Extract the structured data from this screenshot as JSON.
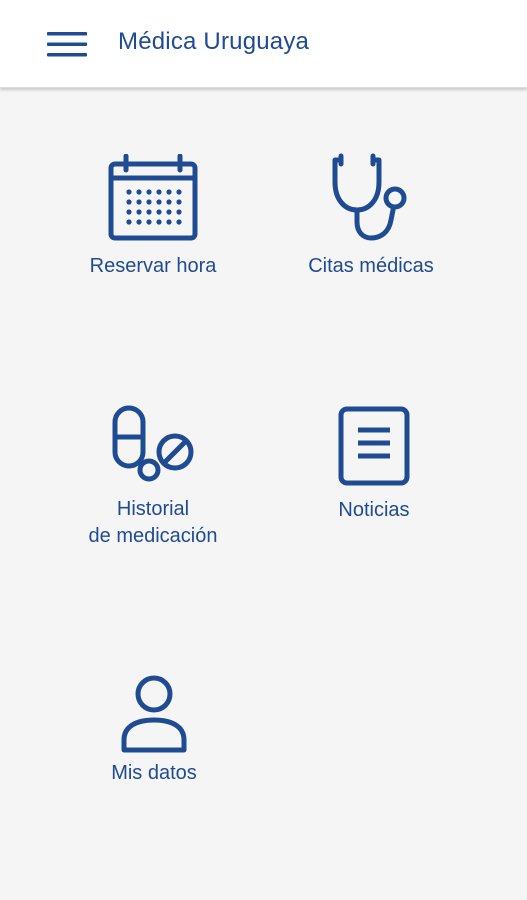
{
  "header": {
    "title": "Médica Uruguaya",
    "menu_icon": "hamburger-menu-icon"
  },
  "menu": {
    "items": [
      {
        "id": "reservar",
        "label": "Reservar hora",
        "icon": "calendar-icon"
      },
      {
        "id": "citas",
        "label": "Citas médicas",
        "icon": "stethoscope-icon"
      },
      {
        "id": "historial",
        "label_line1": "Historial",
        "label_line2": "de medicación",
        "icon": "pills-icon"
      },
      {
        "id": "noticias",
        "label": "Noticias",
        "icon": "document-icon"
      },
      {
        "id": "datos",
        "label": "Mis datos",
        "icon": "user-icon"
      }
    ]
  },
  "colors": {
    "primary": "#1f4b93",
    "background": "#f5f5f5",
    "app_bar": "#ffffff"
  }
}
